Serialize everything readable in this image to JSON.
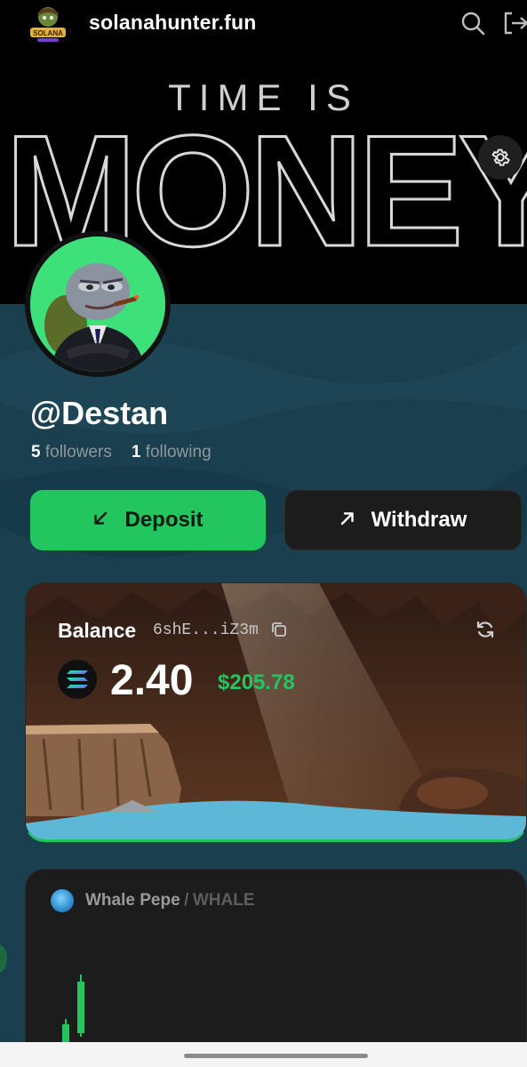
{
  "header": {
    "site_name": "solanahunter.fun",
    "logo_text": "SOLANA",
    "icons": {
      "search": "search-icon",
      "logout": "logout-icon"
    }
  },
  "banner": {
    "line1": "TIME IS",
    "line2": "MONEY",
    "settings_icon": "gear-icon"
  },
  "profile": {
    "username": "@Destan",
    "followers_count": "5",
    "followers_label": "followers",
    "following_count": "1",
    "following_label": "following"
  },
  "actions": {
    "deposit_label": "Deposit",
    "deposit_icon": "arrow-down-left-icon",
    "withdraw_label": "Withdraw",
    "withdraw_icon": "arrow-up-right-icon"
  },
  "balance": {
    "label": "Balance",
    "address": "6shE...iZ3m",
    "amount": "2.40",
    "usd_value": "$205.78",
    "token_icon": "solana-icon"
  },
  "token": {
    "name": "Whale Pepe",
    "separator": "/",
    "symbol": "WHALE"
  },
  "colors": {
    "accent_green": "#22c55e",
    "page_bg": "#1a3f4f",
    "card_dark": "#1c1c1c"
  }
}
